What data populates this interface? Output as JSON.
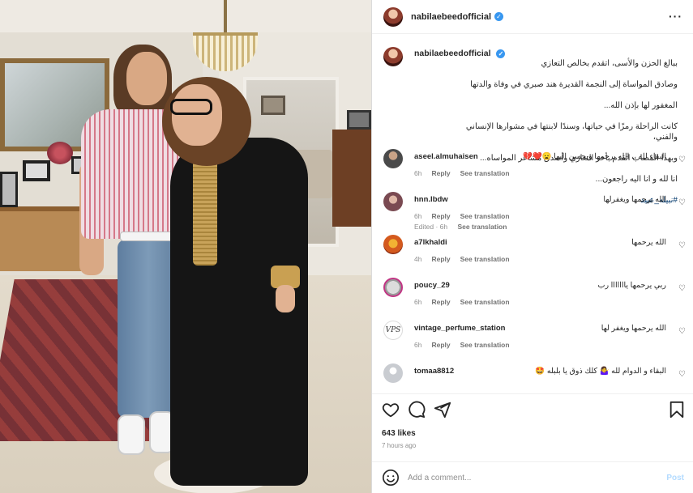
{
  "post": {
    "username": "nabilaebeedofficial",
    "caption_lines": [
      "ببالغ الحزن والأسى، اتقدم بخالص التعازي",
      "وصادق المواساة إلى النجمة القديرة هند صبري في وفاة والدتها",
      "المغفور لها بإذن الله...",
      "كانت الراحلة رمزًا في حياتها، وسندًا لابنتها في مشوارها الإنساني والفني،",
      "وبهذا المصاب اتقدم بأحر التعازي وأصدق مشاعر المواساه...",
      "انا لله و انا اليه راجعون..."
    ],
    "hashtag": "#نبيله_عبيد",
    "edited": "Edited · 6h",
    "see_translation": "See translation",
    "likes": "643 likes",
    "time_ago": "7 hours ago"
  },
  "comments": [
    {
      "user": "aseel.almuhaisen",
      "text": "البقاء لله ،، الله يرحمها ويحسن اليها 😦❤️💔",
      "time": "6h",
      "reply": "Reply",
      "translate": "See translation",
      "avatar_color": "#4a4a4a"
    },
    {
      "user": "hnn.lbdw",
      "text": "الله يرحمها ويغفرلها",
      "time": "6h",
      "reply": "Reply",
      "translate": "See translation",
      "avatar_color": "#7a4a52"
    },
    {
      "user": "a7lkhaldi",
      "text": "الله يرحمها",
      "time": "4h",
      "reply": "Reply",
      "translate": "See translation",
      "avatar_color": "#d45a1e"
    },
    {
      "user": "poucy_29",
      "text": "ربي يرحمها يااااااا رب",
      "time": "6h",
      "reply": "Reply",
      "translate": "See translation",
      "avatar_color": "#9a9a9a"
    },
    {
      "user": "vintage_perfume_station",
      "text": "الله يرحمها ويغفر لها",
      "time": "6h",
      "reply": "Reply",
      "translate": "See translation",
      "avatar_color": "#ffffff"
    },
    {
      "user": "tomaa8812",
      "text": "البقاء و الدوام لله 🤷‍♀️ كلك ذوق يا بلبله 🤩",
      "time": "",
      "reply": "",
      "translate": "",
      "avatar_color": "#c9ccd1"
    }
  ],
  "add_comment": {
    "placeholder": "Add a comment...",
    "post_label": "Post"
  },
  "icons": [
    "more-icon",
    "heart-icon",
    "comment-icon",
    "share-icon",
    "bookmark-icon",
    "emoji-icon",
    "verified-icon"
  ],
  "colors": {
    "verified": "#3897f0",
    "link": "#00376b",
    "muted": "#8e8e8e",
    "post_button": "#b3dbff"
  }
}
